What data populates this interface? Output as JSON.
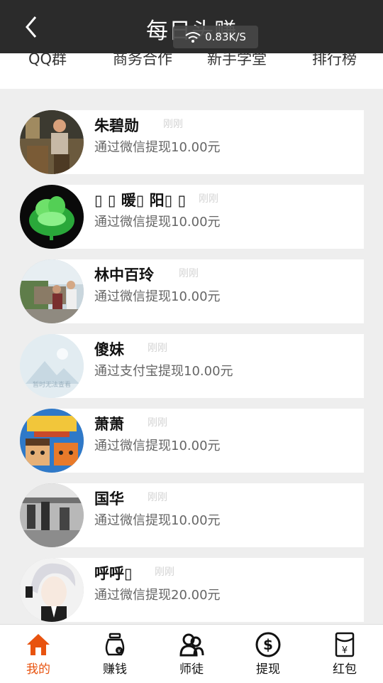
{
  "header": {
    "title": "每日头赚",
    "speed": "0.83K/S"
  },
  "tabs": [
    "QQ群",
    "商务合作",
    "新手学堂",
    "排行榜"
  ],
  "feed": [
    {
      "name": "朱碧勋",
      "time": "刚刚",
      "desc": "通过微信提现10.00元"
    },
    {
      "name": "▯ ▯ 暖▯ 阳▯ ▯",
      "time": "刚刚",
      "desc": "通过微信提现10.00元"
    },
    {
      "name": "林中百玲",
      "time": "刚刚",
      "desc": "通过微信提现10.00元"
    },
    {
      "name": "傻妹",
      "time": "刚刚",
      "desc": "通过支付宝提现10.00元",
      "avatar_text": "暂时无法查看"
    },
    {
      "name": "萧萧",
      "time": "刚刚",
      "desc": "通过微信提现10.00元"
    },
    {
      "name": "国华",
      "time": "刚刚",
      "desc": "通过微信提现10.00元"
    },
    {
      "name": "呼呼▯",
      "time": "刚刚",
      "desc": "通过微信提现20.00元"
    }
  ],
  "bottom_nav": [
    {
      "label": "我的",
      "icon": "home-icon",
      "active": true
    },
    {
      "label": "赚钱",
      "icon": "money-bag-icon",
      "active": false
    },
    {
      "label": "师徒",
      "icon": "people-icon",
      "active": false
    },
    {
      "label": "提现",
      "icon": "dollar-coin-icon",
      "active": false
    },
    {
      "label": "红包",
      "icon": "red-envelope-icon",
      "active": false
    }
  ],
  "colors": {
    "header_bg": "#2b2b2b",
    "accent": "#e8530f",
    "page_bg": "#eeeeee"
  }
}
